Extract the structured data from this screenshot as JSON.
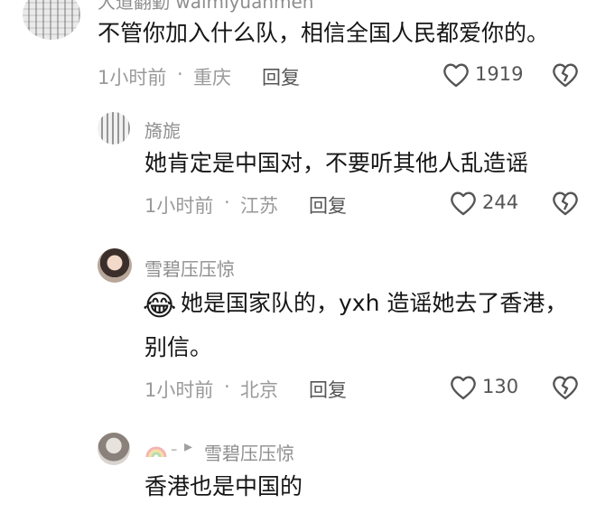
{
  "comments": [
    {
      "username": "大道翻勤 waimiyuanmen",
      "text_lines": [
        "不管你加入什么队，相信全国人民都爱你的。"
      ],
      "time": "1小时前",
      "separator": "·",
      "location": "重庆",
      "reply_label": "回复",
      "likes": "1919"
    },
    {
      "username": "旖旎",
      "text_lines": [
        "她肯定是中国对，不要听其他人乱造谣"
      ],
      "time": "1小时前",
      "separator": "·",
      "location": "江苏",
      "reply_label": "回复",
      "likes": "244"
    },
    {
      "username": "雪碧压压惊",
      "emoji": "😂",
      "text_lines": [
        "她是国家队的，yxh 造谣她去了香港，",
        "别信。"
      ],
      "time": "1小时前",
      "separator": "·",
      "location": "北京",
      "reply_label": "回复",
      "likes": "130"
    },
    {
      "reply_arrow": "▸",
      "reply_to": "雪碧压压惊",
      "text_lines": [
        "香港也是中国的"
      ]
    }
  ],
  "colors": {
    "text": "#161616",
    "meta": "#9a9a9a",
    "name": "#8e8e8e"
  },
  "icons": {
    "like": "heart-outline-icon",
    "dislike": "broken-heart-icon"
  }
}
